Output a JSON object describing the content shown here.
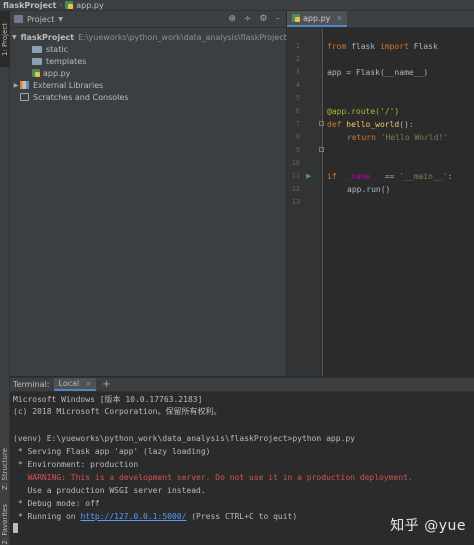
{
  "breadcrumb": {
    "project": "flaskProject",
    "file": "app.py"
  },
  "left_stripe": {
    "project_tab": "1: Project",
    "structure_tab": "Z: Structure",
    "favorites_tab": "2: Favorites"
  },
  "project_panel": {
    "title": "Project",
    "tree": [
      {
        "label": "flaskProject",
        "path": "E:\\yueworks\\python_work\\data_analysis\\flaskProject"
      },
      {
        "label": "static"
      },
      {
        "label": "templates"
      },
      {
        "label": "app.py"
      },
      {
        "label": "External Libraries"
      },
      {
        "label": "Scratches and Consoles"
      }
    ]
  },
  "editor": {
    "tab_label": "app.py",
    "line_numbers": [
      "1",
      "2",
      "3",
      "4",
      "5",
      "6",
      "7",
      "8",
      "9",
      "10",
      "11",
      "12",
      "13"
    ],
    "code": {
      "l1_from": "from",
      "l1_mod": " flask ",
      "l1_import": "import",
      "l1_name": " Flask",
      "l3": "app = Flask(__name__)",
      "l6": "@app.route('/')",
      "l7_def": "def",
      "l7_name": " hello_world",
      "l7_rest": "():",
      "l8_return": "return",
      "l8_str": "'Hello World!'",
      "l11_if": "if",
      "l11_dunder": " __name__",
      "l11_eq": " == ",
      "l11_str": "'__main__'",
      "l11_colon": ":",
      "l12": "app.run()"
    }
  },
  "terminal": {
    "label": "Terminal:",
    "tab": "Local",
    "add_symbol": "+",
    "lines": [
      "Microsoft Windows [版本 10.0.17763.2183]",
      "(c) 2018 Microsoft Corporation。保留所有权利。",
      "",
      "(venv) E:\\yueworks\\python_work\\data_analysis\\flaskProject>python app.py",
      " * Serving Flask app 'app' (lazy loading)",
      " * Environment: production",
      "   WARNING: This is a development server. Do not use it in a production deployment.",
      "   Use a production WSGI server instead.",
      " * Debug mode: off"
    ],
    "running_prefix": " * Running on ",
    "running_url": "http://127.0.0.1:5000/",
    "running_suffix": " (Press CTRL+C to quit)"
  },
  "watermark": "知乎 @yue"
}
